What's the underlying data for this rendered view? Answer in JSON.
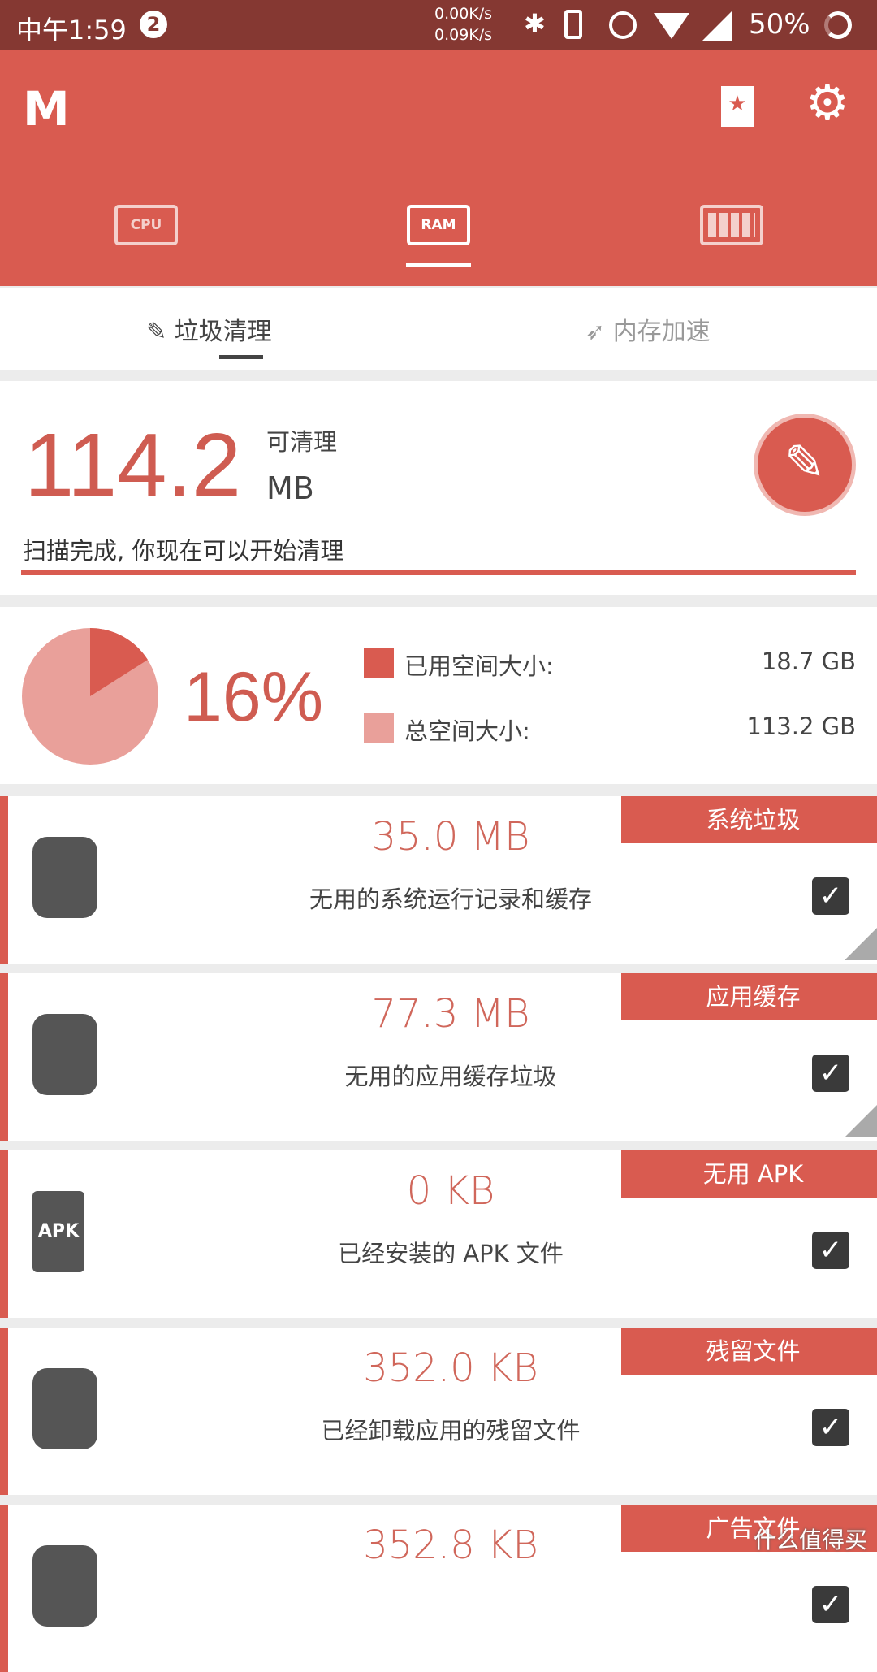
{
  "status": {
    "time": "中午1:59",
    "notif_count": "2",
    "net_up": "0.00K/s",
    "net_down": "0.09K/s",
    "battery": "50%"
  },
  "header": {
    "logo": "M",
    "tabs": [
      {
        "label": "CPU"
      },
      {
        "label": "RAM",
        "active": true
      },
      {
        "label": "battery"
      }
    ]
  },
  "subtabs": [
    {
      "label": "垃圾清理",
      "active": true
    },
    {
      "label": "内存加速"
    }
  ],
  "summary": {
    "amount": "114.2",
    "label": "可清理",
    "unit": "MB",
    "status": "扫描完成, 你现在可以开始清理",
    "progress": 100
  },
  "storage": {
    "percent": "16%",
    "percent_value": 16,
    "used_label": "已用空间大小:",
    "used_value": "18.7 GB",
    "total_label": "总空间大小:",
    "total_value": "113.2 GB",
    "used_color": "#d95b50",
    "total_color": "#e9a09a"
  },
  "items": [
    {
      "tag": "系统垃圾",
      "amount": "35.0 MB",
      "desc": "无用的系统运行记录和缓存",
      "icon": "android-icon",
      "checked": true
    },
    {
      "tag": "应用缓存",
      "amount": "77.3 MB",
      "desc": "无用的应用缓存垃圾",
      "icon": "android-head-icon",
      "checked": true
    },
    {
      "tag": "无用 APK",
      "amount": "0 KB",
      "desc": "已经安装的 APK 文件",
      "icon": "apk-file-icon",
      "checked": true
    },
    {
      "tag": "残留文件",
      "amount": "352.0 KB",
      "desc": "已经卸载应用的残留文件",
      "icon": "puzzle-icon",
      "checked": true
    },
    {
      "tag": "广告文件",
      "amount": "352.8 KB",
      "desc": "",
      "icon": "ad-icon",
      "checked": true
    }
  ],
  "watermark": "什么值得买",
  "colors": {
    "accent": "#d95b50",
    "status_bar": "#853832"
  }
}
